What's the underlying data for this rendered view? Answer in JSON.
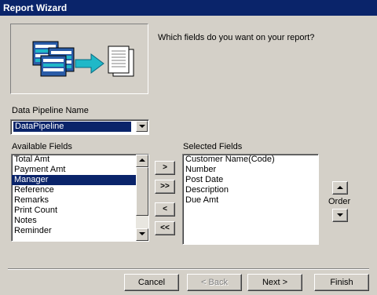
{
  "window": {
    "title": "Report Wizard"
  },
  "question": "Which fields do you want on your report?",
  "pipeline": {
    "label": "Data Pipeline Name",
    "value": "DataPipeline"
  },
  "available": {
    "label": "Available Fields",
    "items": [
      "Total Amt",
      "Payment Amt",
      "Manager",
      "Reference",
      "Remarks",
      "Print Count",
      "Notes",
      "Reminder"
    ],
    "selected_item": "Manager"
  },
  "selected": {
    "label": "Selected Fields",
    "items": [
      "Customer Name(Code)",
      "Number",
      "Post Date",
      "Description",
      "Due Amt"
    ]
  },
  "move_buttons": {
    "add_one": ">",
    "add_all": ">>",
    "remove_one": "<",
    "remove_all": "<<"
  },
  "order": {
    "label": "Order"
  },
  "footer": {
    "cancel": "Cancel",
    "back": "< Back",
    "next": "Next >",
    "finish": "Finish"
  },
  "colors": {
    "title_bar": "#0a246a",
    "selection": "#0a246a",
    "face": "#d4d0c8",
    "teal": "#1fb8c8"
  }
}
